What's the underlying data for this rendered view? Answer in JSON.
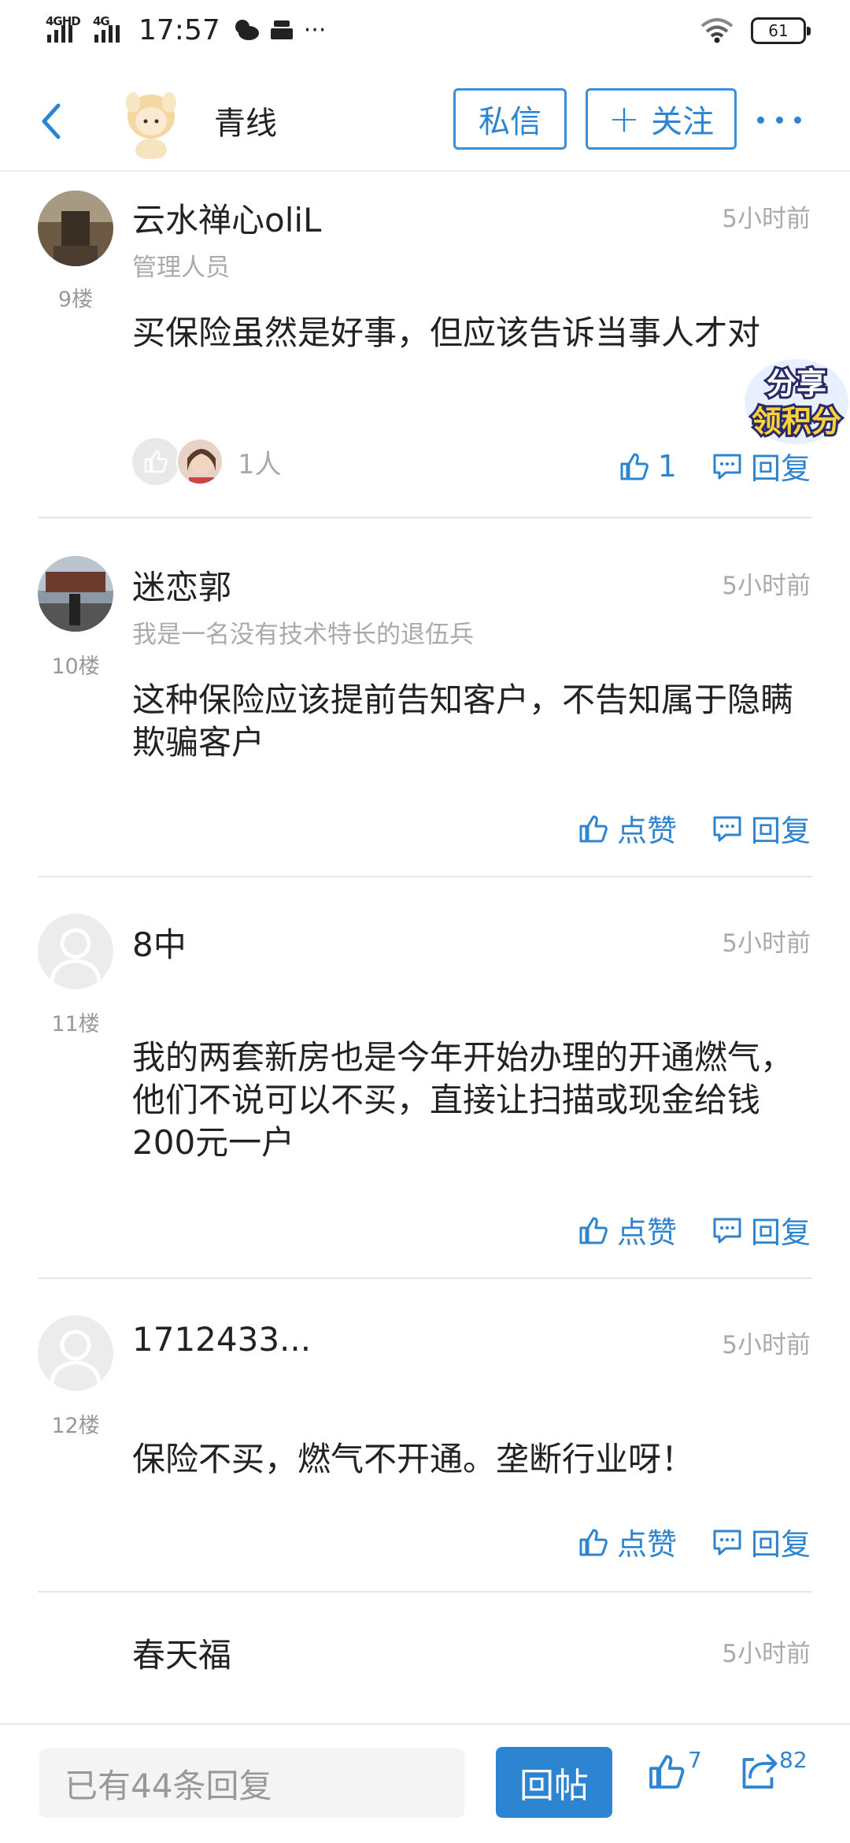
{
  "status_bar": {
    "signal_1": "4GHD",
    "signal_2": "4G",
    "time": "17:57",
    "more": "···",
    "battery": "61"
  },
  "header": {
    "author_name": "青线",
    "dm_label": "私信",
    "follow_plus": "+",
    "follow_label": "关注"
  },
  "comments": [
    {
      "name": "云水禅心oliL",
      "role": "管理人员",
      "time": "5小时前",
      "floor": "9楼",
      "body": "买保险虽然是好事，但应该告诉当事人才对",
      "likers_count": "1人",
      "like_label": "1",
      "reply_label": "回复"
    },
    {
      "name": "迷恋郭",
      "role": "我是一名没有技术特长的退伍兵",
      "time": "5小时前",
      "floor": "10楼",
      "body": "这种保险应该提前告知客户，不告知属于隐瞒欺骗客户",
      "like_label": "点赞",
      "reply_label": "回复"
    },
    {
      "name": "8中",
      "time": "5小时前",
      "floor": "11楼",
      "body": "我的两套新房也是今年开始办理的开通燃气，他们不说可以不买，直接让扫描或现金给钱200元一户",
      "like_label": "点赞",
      "reply_label": "回复"
    },
    {
      "name": "1712433...",
      "time": "5小时前",
      "floor": "12楼",
      "body": "保险不买，燃气不开通。垄断行业呀！",
      "like_label": "点赞",
      "reply_label": "回复"
    },
    {
      "name": "春天福",
      "time": "5小时前"
    }
  ],
  "share_badge": {
    "line1": "分享",
    "line2": "领积分"
  },
  "bottom_bar": {
    "input_placeholder": "已有44条回复",
    "post_label": "回帖",
    "like_count": "7",
    "share_count": "82"
  },
  "colors": {
    "accent": "#2d84d0",
    "muted_text": "#aaaaaa",
    "divider": "#e6e6e6"
  }
}
